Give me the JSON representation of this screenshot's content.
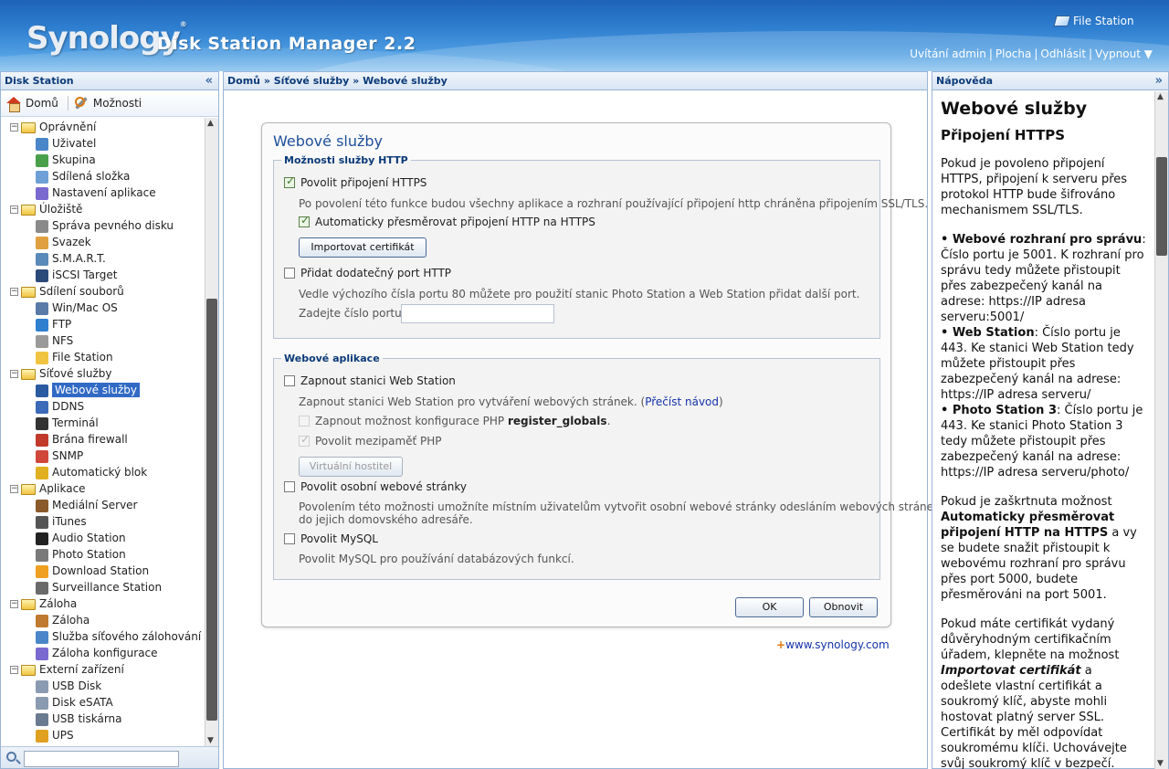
{
  "header": {
    "logo": "Synology",
    "product": "Disk Station Manager 2.2",
    "file_station": "File Station",
    "links": [
      "Uvítání admin",
      "Plocha",
      "Odhlásit",
      "Vypnout ▼"
    ]
  },
  "left_panel": {
    "title": "Disk Station",
    "toolbar": {
      "home": "Domů",
      "options": "Možnosti"
    },
    "tree": [
      {
        "type": "cat",
        "label": "Oprávnění"
      },
      {
        "type": "item",
        "label": "Uživatel",
        "icon": "user-icon",
        "color": "#4a86c8"
      },
      {
        "type": "item",
        "label": "Skupina",
        "icon": "group-icon",
        "color": "#4aa04a"
      },
      {
        "type": "item",
        "label": "Sdílená složka",
        "icon": "shared-folder-icon",
        "color": "#6e9fd6"
      },
      {
        "type": "item",
        "label": "Nastavení aplikace",
        "icon": "app-settings-icon",
        "color": "#7a6ad0"
      },
      {
        "type": "cat",
        "label": "Úložiště"
      },
      {
        "type": "item",
        "label": "Správa pevného disku",
        "icon": "hdd-icon",
        "color": "#8a8a8a"
      },
      {
        "type": "item",
        "label": "Svazek",
        "icon": "volume-icon",
        "color": "#e0a040"
      },
      {
        "type": "item",
        "label": "S.M.A.R.T.",
        "icon": "smart-icon",
        "color": "#5a8ab8"
      },
      {
        "type": "item",
        "label": "iSCSI Target",
        "icon": "iscsi-icon",
        "color": "#2b4a7a"
      },
      {
        "type": "cat",
        "label": "Sdílení souborů"
      },
      {
        "type": "item",
        "label": "Win/Mac OS",
        "icon": "winmac-icon",
        "color": "#5a7aa8"
      },
      {
        "type": "item",
        "label": "FTP",
        "icon": "ftp-icon",
        "color": "#2f7fd0"
      },
      {
        "type": "item",
        "label": "NFS",
        "icon": "nfs-icon",
        "color": "#9a9a9a"
      },
      {
        "type": "item",
        "label": "File Station",
        "icon": "file-station-icon",
        "color": "#f0c440"
      },
      {
        "type": "cat",
        "label": "Síťové služby"
      },
      {
        "type": "item",
        "label": "Webové služby",
        "icon": "web-services-icon",
        "color": "#2a5aa0",
        "selected": true
      },
      {
        "type": "item",
        "label": "DDNS",
        "icon": "ddns-icon",
        "color": "#3a6ab8"
      },
      {
        "type": "item",
        "label": "Terminál",
        "icon": "terminal-icon",
        "color": "#333333"
      },
      {
        "type": "item",
        "label": "Brána firewall",
        "icon": "firewall-icon",
        "color": "#c0392b"
      },
      {
        "type": "item",
        "label": "SNMP",
        "icon": "snmp-icon",
        "color": "#d0483a"
      },
      {
        "type": "item",
        "label": "Automatický blok",
        "icon": "lock-icon",
        "color": "#e0b020"
      },
      {
        "type": "cat",
        "label": "Aplikace"
      },
      {
        "type": "item",
        "label": "Mediální Server",
        "icon": "media-server-icon",
        "color": "#8a5a2a"
      },
      {
        "type": "item",
        "label": "iTunes",
        "icon": "headphones-icon",
        "color": "#555555"
      },
      {
        "type": "item",
        "label": "Audio Station",
        "icon": "music-note-icon",
        "color": "#222222"
      },
      {
        "type": "item",
        "label": "Photo Station",
        "icon": "photo-icon",
        "color": "#7a7a7a"
      },
      {
        "type": "item",
        "label": "Download Station",
        "icon": "download-icon",
        "color": "#f0a020"
      },
      {
        "type": "item",
        "label": "Surveillance Station",
        "icon": "camera-icon",
        "color": "#6a6a6a"
      },
      {
        "type": "cat",
        "label": "Záloha"
      },
      {
        "type": "item",
        "label": "Záloha",
        "icon": "backup-icon",
        "color": "#c07a30"
      },
      {
        "type": "item",
        "label": "Služba síťového zálohování",
        "icon": "network-backup-icon",
        "color": "#4a86c8"
      },
      {
        "type": "item",
        "label": "Záloha konfigurace",
        "icon": "config-backup-icon",
        "color": "#7a6ad0"
      },
      {
        "type": "cat",
        "label": "Externí zařízení"
      },
      {
        "type": "item",
        "label": "USB Disk",
        "icon": "usb-disk-icon",
        "color": "#8a9ab0"
      },
      {
        "type": "item",
        "label": "Disk eSATA",
        "icon": "esata-icon",
        "color": "#8a9ab0"
      },
      {
        "type": "item",
        "label": "USB tiskárna",
        "icon": "printer-icon",
        "color": "#6a7a90"
      },
      {
        "type": "item",
        "label": "UPS",
        "icon": "ups-icon",
        "color": "#e0a020"
      }
    ]
  },
  "breadcrumb": [
    "Domů",
    "Síťové služby",
    "Webové služby"
  ],
  "form": {
    "title": "Webové služby",
    "http_group": {
      "legend": "Možnosti služby HTTP",
      "https_label": "Povolit připojení HTTPS",
      "https_desc": "Po povolení této funkce budou všechny aplikace a rozhraní používající připojení http chráněna připojením SSL/TLS.",
      "redirect_label": "Automaticky přesměrovat připojení HTTP na HTTPS",
      "import_cert": "Importovat certifikát",
      "extra_port_label": "Přidat dodatečný port HTTP",
      "extra_port_desc": "Vedle výchozího čísla portu 80 můžete pro použití stanic Photo Station a Web Station přidat další port.",
      "port_label": "Zadejte číslo portu:",
      "port_value": ""
    },
    "web_apps_group": {
      "legend": "Webové aplikace",
      "web_station_label": "Zapnout stanici Web Station",
      "web_station_desc": "Zapnout stanici Web Station pro vytváření webových stránek. (",
      "read_guide": "Přečíst návod",
      "web_station_desc_end": ")",
      "php_globals_label": "Zapnout možnost konfigurace PHP ",
      "php_globals_bold": "register_globals",
      "php_globals_end": ".",
      "php_cache_label": "Povolit mezipaměť PHP",
      "virtual_host": "Virtuální hostitel",
      "personal_label": "Povolit osobní webové stránky",
      "personal_desc_1": "Povolením této možnosti umožníte místním uživatelům vytvořit osobní webové stránky odesláním webových stránek",
      "personal_desc_2": "do jejich domovského adresáře.",
      "mysql_label": "Povolit MySQL",
      "mysql_desc": "Povolit MySQL pro používání databázových funkcí."
    },
    "ok": "OK",
    "reset": "Obnovit"
  },
  "footer_link": {
    "plus": "+",
    "text": "www.synology.com"
  },
  "help": {
    "panel_title": "Nápověda",
    "h1": "Webové služby",
    "h2": "Připojení HTTPS",
    "p1": "Pokud je povoleno připojení HTTPS, připojení k serveru přes protokol HTTP bude šifrováno mechanismem SSL/TLS.",
    "b1_bold": "Webové rozhraní pro správu",
    "b1_text": ": Číslo portu je 5001. K rozhraní pro správu tedy můžete přistoupit přes zabezpečený kanál na adrese: https://IP adresa serveru:5001/",
    "b2_bold": "Web Station",
    "b2_text": ": Číslo portu je 443. Ke stanici Web Station tedy můžete přistoupit přes zabezpečený kanál na adrese: https://IP adresa serveru/",
    "b3_bold": "Photo Station 3",
    "b3_text": ": Číslo portu je 443. Ke stanici Photo Station 3 tedy můžete přistoupit přes zabezpečený kanál na adrese: https://IP adresa serveru/photo/",
    "p2_a": "Pokud je zaškrtnuta možnost ",
    "p2_bold": "Automaticky přesměrovat připojení HTTP na HTTPS",
    "p2_b": " a vy se budete snažit přistoupit k webovému rozhraní pro správu přes port 5000, budete přesměrováni na port 5001.",
    "p3_a": "Pokud máte certifikát vydaný důvěryhodným certifikačním úřadem, klepněte na možnost ",
    "p3_bold": "Importovat certifikát",
    "p3_b": " a odešlete vlastní certifikát a soukromý klíč, abyste mohli hostovat platný server SSL. Certifikát by měl odpovídat soukromému klíči. Uchovávejte svůj soukromý klíč v bezpečí."
  }
}
